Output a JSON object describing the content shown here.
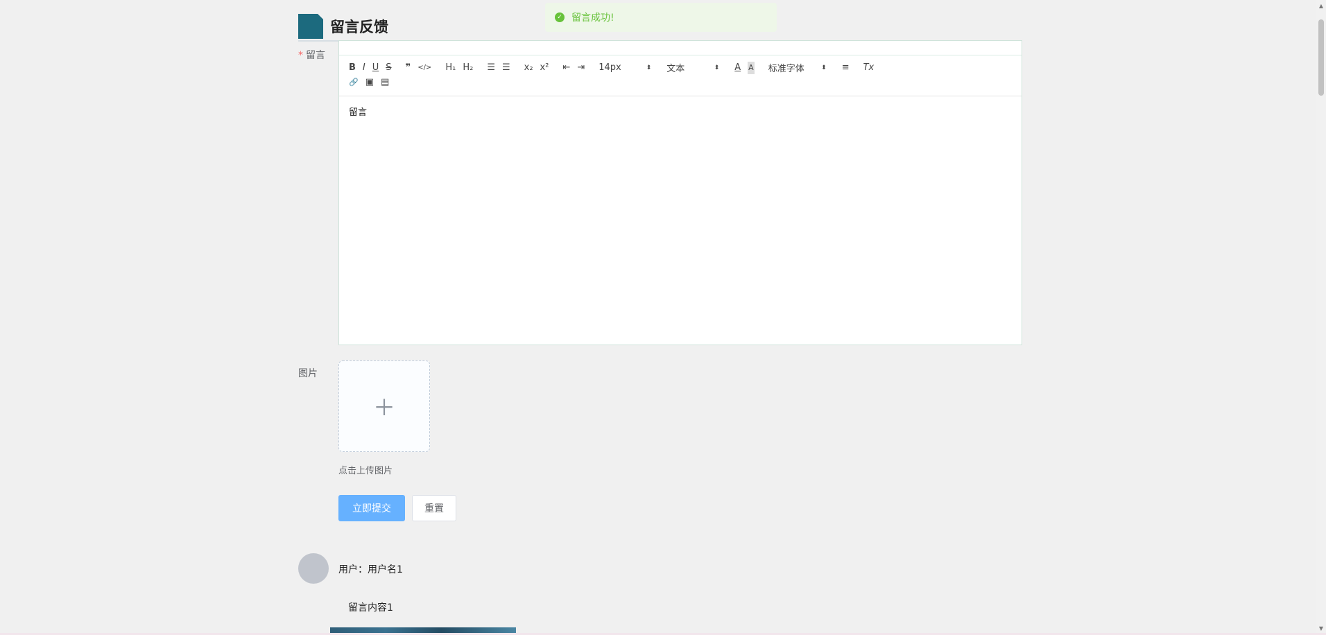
{
  "toast": {
    "icon": "check-circle-icon",
    "text": "留言成功!"
  },
  "page": {
    "title": "留言反馈"
  },
  "form": {
    "message_label": "留言",
    "message_required_mark": "*",
    "image_label": "图片",
    "upload_icon": "plus-icon",
    "upload_hint": "点击上传图片",
    "submit_label": "立即提交",
    "reset_label": "重置"
  },
  "editor": {
    "toolbar": {
      "bold": "B",
      "italic": "I",
      "underline": "U",
      "strike": "S",
      "blockquote": "❞",
      "code": "</>",
      "h1": "H₁",
      "h2": "H₂",
      "ordered_list": "☰",
      "bullet_list": "☰",
      "subscript": "x₂",
      "superscript": "x²",
      "indent_decrease": "⇤",
      "indent_increase": "⇥",
      "font_size": "14px",
      "header_type": "文本",
      "font_family": "标准字体",
      "text_color": "A",
      "background_color": "A",
      "align": "≡",
      "clean": "Tx",
      "link": "🔗",
      "image": "▣",
      "video": "▤"
    },
    "content": "留言"
  },
  "comments": [
    {
      "user_prefix": "用户：",
      "user_name": "用户名1",
      "content": "留言内容1"
    }
  ]
}
